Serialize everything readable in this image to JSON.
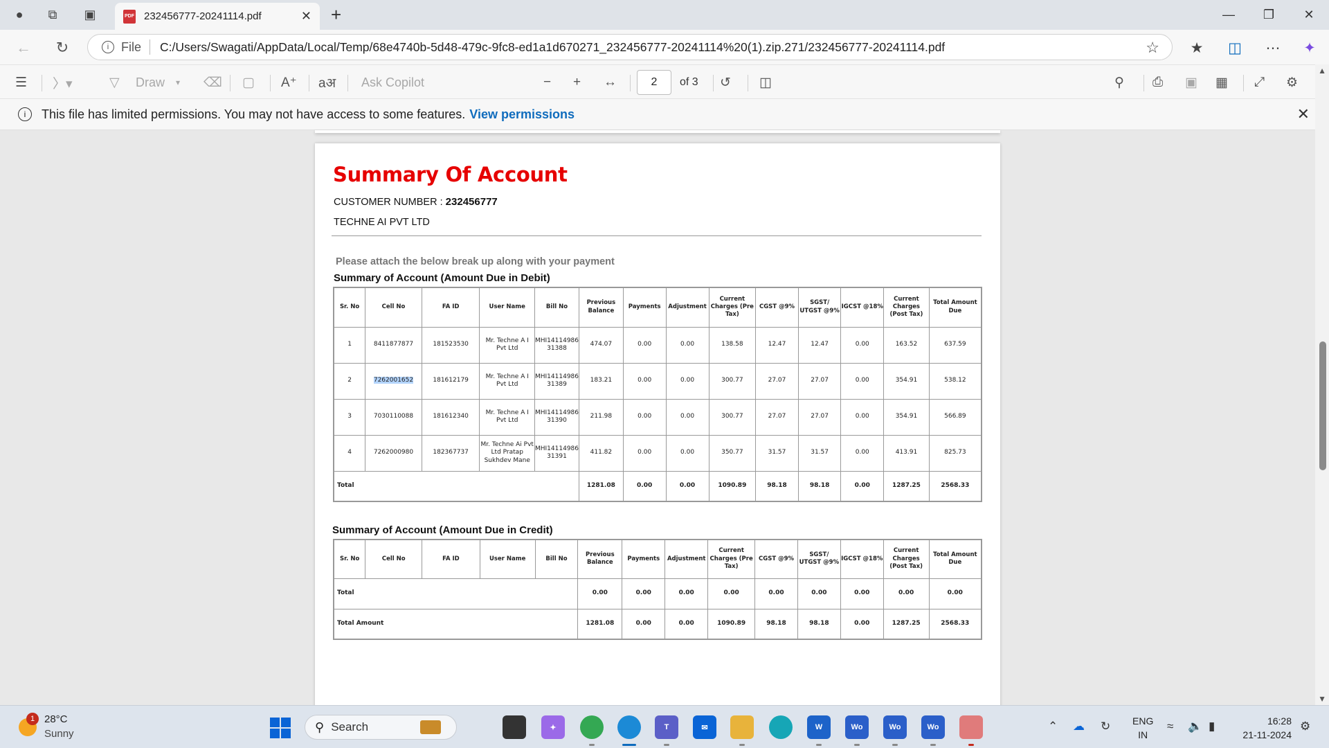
{
  "browser": {
    "tab_title": "232456777-20241114.pdf",
    "pdf_badge": "PDF",
    "address_scheme": "File",
    "url": "C:/Users/Swagati/AppData/Local/Temp/68e4740b-5d48-479c-9fc8-ed1a1d670271_232456777-20241114%20(1).zip.271/232456777-20241114.pdf"
  },
  "pdf_toolbar": {
    "draw_label": "Draw",
    "ask_copilot": "Ask Copilot",
    "current_page": "2",
    "page_total": "of 3"
  },
  "banner": {
    "message": "This file has limited permissions. You may not have access to some features.",
    "link": "View permissions"
  },
  "document": {
    "title": "Summary Of Account",
    "customer_label": "CUSTOMER NUMBER : ",
    "customer_number": "232456777",
    "company": "TECHNE AI PVT LTD",
    "attach_note": "Please attach the below break up along with your payment",
    "debit_title": "Summary of Account (Amount Due in Debit)",
    "credit_title": "Summary of Account (Amount Due in Credit)",
    "headers": [
      "Sr. No",
      "Cell No",
      "FA ID",
      "User Name",
      "Bill No",
      "Previous Balance",
      "Payments",
      "Adjustment",
      "Current Charges (Pre Tax)",
      "CGST @9%",
      "SGST/ UTGST @9%",
      "IGCST @18%",
      "Current Charges (Post Tax)",
      "Total Amount Due"
    ],
    "debit_rows": [
      {
        "sr": "1",
        "cell": "8411877877",
        "faid": "181523530",
        "user": "Mr. Techne A I Pvt Ltd",
        "bill": "MHI14114986 31388",
        "prev": "474.07",
        "pay": "0.00",
        "adj": "0.00",
        "pre": "138.58",
        "cgst": "12.47",
        "sgst": "12.47",
        "igst": "0.00",
        "post": "163.52",
        "total": "637.59"
      },
      {
        "sr": "2",
        "cell": "7262001652",
        "faid": "181612179",
        "user": "Mr. Techne A I Pvt Ltd",
        "bill": "MHI14114986 31389",
        "prev": "183.21",
        "pay": "0.00",
        "adj": "0.00",
        "pre": "300.77",
        "cgst": "27.07",
        "sgst": "27.07",
        "igst": "0.00",
        "post": "354.91",
        "total": "538.12"
      },
      {
        "sr": "3",
        "cell": "7030110088",
        "faid": "181612340",
        "user": "Mr. Techne A I Pvt Ltd",
        "bill": "MHI14114986 31390",
        "prev": "211.98",
        "pay": "0.00",
        "adj": "0.00",
        "pre": "300.77",
        "cgst": "27.07",
        "sgst": "27.07",
        "igst": "0.00",
        "post": "354.91",
        "total": "566.89"
      },
      {
        "sr": "4",
        "cell": "7262000980",
        "faid": "182367737",
        "user": "Mr. Techne Ai Pvt Ltd Pratap Sukhdev Mane",
        "bill": "MHI14114986 31391",
        "prev": "411.82",
        "pay": "0.00",
        "adj": "0.00",
        "pre": "350.77",
        "cgst": "31.57",
        "sgst": "31.57",
        "igst": "0.00",
        "post": "413.91",
        "total": "825.73"
      }
    ],
    "debit_total": {
      "label": "Total",
      "prev": "1281.08",
      "pay": "0.00",
      "adj": "0.00",
      "pre": "1090.89",
      "cgst": "98.18",
      "sgst": "98.18",
      "igst": "0.00",
      "post": "1287.25",
      "total": "2568.33"
    },
    "credit_total": {
      "label": "Total",
      "prev": "0.00",
      "pay": "0.00",
      "adj": "0.00",
      "pre": "0.00",
      "cgst": "0.00",
      "sgst": "0.00",
      "igst": "0.00",
      "post": "0.00",
      "total": "0.00"
    },
    "total_amount": {
      "label": "Total Amount",
      "prev": "1281.08",
      "pay": "0.00",
      "adj": "0.00",
      "pre": "1090.89",
      "cgst": "98.18",
      "sgst": "98.18",
      "igst": "0.00",
      "post": "1287.25",
      "total": "2568.33"
    }
  },
  "taskbar": {
    "weather_badge": "1",
    "temperature": "28°C",
    "condition": "Sunny",
    "search_placeholder": "Search",
    "lang_line1": "ENG",
    "lang_line2": "IN",
    "time": "16:28",
    "date": "21-11-2024",
    "word_label": "Wo"
  },
  "colors": {
    "title_red": "#e60000",
    "link_blue": "#0f6cbd",
    "selection": "#b3d4fc"
  }
}
